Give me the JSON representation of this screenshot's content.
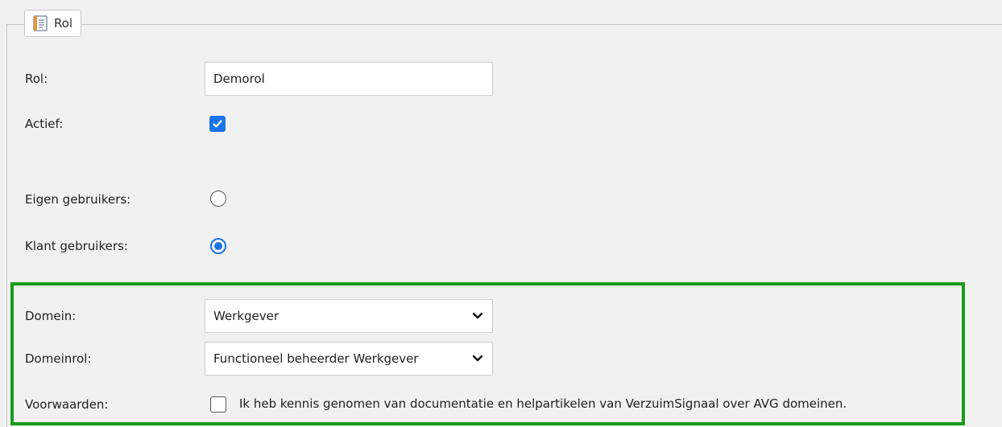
{
  "section": {
    "legend_label": "Rol",
    "legend_icon": "notepad-icon"
  },
  "form": {
    "rol": {
      "label": "Rol:",
      "value": "Demorol"
    },
    "actief": {
      "label": "Actief:",
      "checked": true
    },
    "eigen_gebruikers": {
      "label": "Eigen gebruikers:",
      "selected": false
    },
    "klant_gebruikers": {
      "label": "Klant gebruikers:",
      "selected": true
    },
    "domein": {
      "label": "Domein:",
      "value": "Werkgever"
    },
    "domeinrol": {
      "label": "Domeinrol:",
      "value": "Functioneel beheerder Werkgever"
    },
    "voorwaarden": {
      "label": "Voorwaarden:",
      "checked": false,
      "text": "Ik heb kennis genomen van documentatie en helpartikelen van VerzuimSignaal over AVG domeinen."
    }
  },
  "colors": {
    "accent": "#1a73e8",
    "highlight_border": "#1a9a1a",
    "background": "#f1f1f1"
  }
}
